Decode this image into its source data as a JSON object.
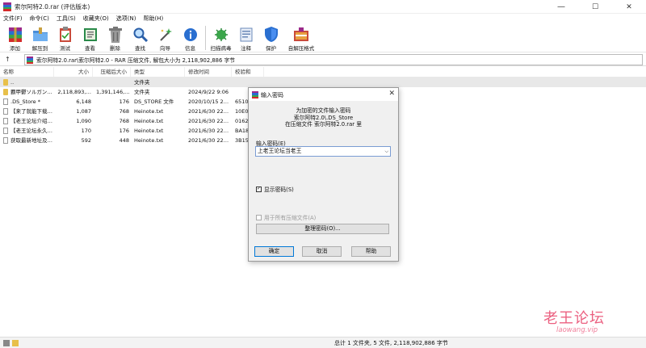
{
  "window": {
    "title": "索尔阿特2.0.rar (评估版本)",
    "minimize": "—",
    "maximize": "☐",
    "close": "✕"
  },
  "menu": [
    "文件(F)",
    "命令(C)",
    "工具(S)",
    "收藏夹(O)",
    "选项(N)",
    "帮助(H)"
  ],
  "toolbar": [
    {
      "label": "添加",
      "icon": "add-archive-icon"
    },
    {
      "label": "解压到",
      "icon": "extract-to-folder-icon"
    },
    {
      "label": "测试",
      "icon": "test-clipboard-icon"
    },
    {
      "label": "查看",
      "icon": "view-book-icon"
    },
    {
      "label": "删除",
      "icon": "trash-icon"
    },
    {
      "label": "查找",
      "icon": "magnifier-icon"
    },
    {
      "label": "向导",
      "icon": "wizard-wand-icon"
    },
    {
      "label": "信息",
      "icon": "info-icon"
    },
    {
      "label": "扫描病毒",
      "icon": "virus-scan-icon"
    },
    {
      "label": "注释",
      "icon": "comment-icon"
    },
    {
      "label": "保护",
      "icon": "shield-icon"
    },
    {
      "label": "自解压格式",
      "icon": "sfx-icon"
    }
  ],
  "address": {
    "up": "↑",
    "path": "索尔阿特2.0.rar\\索尔阿特2.0 - RAR 压缩文件, 解包大小为 2,118,902,886 字节"
  },
  "columns": [
    "名称",
    "大小",
    "压缩后大小",
    "类型",
    "修改时间",
    "校验和"
  ],
  "files": [
    {
      "name": "..",
      "size": "",
      "packed": "",
      "type": "文件夹",
      "modified": "",
      "crc": "",
      "icon": "folder"
    },
    {
      "name": "覇甲鬱ソルガン…",
      "size": "2,118,893,…",
      "packed": "1,391,146,…",
      "type": "文件夹",
      "modified": "2024/9/22 9:06",
      "crc": "",
      "icon": "folder"
    },
    {
      "name": ".DS_Store *",
      "size": "6,148",
      "packed": "176",
      "type": "DS_STORE 文件",
      "modified": "2020/10/15 2…",
      "crc": "6510…",
      "icon": "file"
    },
    {
      "name": "【来了就能下载…",
      "size": "1,087",
      "packed": "768",
      "type": "Heinote.txt",
      "modified": "2021/6/30 22…",
      "crc": "10E0…",
      "icon": "file"
    },
    {
      "name": "【老王论坛介绍…",
      "size": "1,090",
      "packed": "768",
      "type": "Heinote.txt",
      "modified": "2021/6/30 22…",
      "crc": "0162…",
      "icon": "file"
    },
    {
      "name": "【老王论坛永久…",
      "size": "170",
      "packed": "176",
      "type": "Heinote.txt",
      "modified": "2021/6/30 22…",
      "crc": "BA18…",
      "icon": "file"
    },
    {
      "name": "获取最新地址及…",
      "size": "592",
      "packed": "448",
      "type": "Heinote.txt",
      "modified": "2021/6/30 22…",
      "crc": "3B15…",
      "icon": "file"
    }
  ],
  "status": {
    "text": "总计 1 文件夹, 5 文件, 2,118,902,886 字节"
  },
  "watermark": {
    "title": "老王论坛",
    "url": "laowang.vip"
  },
  "dialog": {
    "title": "输入密码",
    "close": "✕",
    "message_lines": [
      "为加密的文件输入密码",
      "索尔阿特2.0\\.DS_Store",
      "在压缩文件 索尔阿特2.0.rar 里"
    ],
    "password_label": "输入密码(E)",
    "password_value": "上老王论坛当老王",
    "show_password_label": "显示密码(S)",
    "show_password_checked": true,
    "use_all_label": "用于所有压缩文件(A)",
    "use_all_checked": false,
    "organize_label": "整理密码(O)...",
    "ok_label": "确定",
    "cancel_label": "取消",
    "help_label": "帮助"
  }
}
